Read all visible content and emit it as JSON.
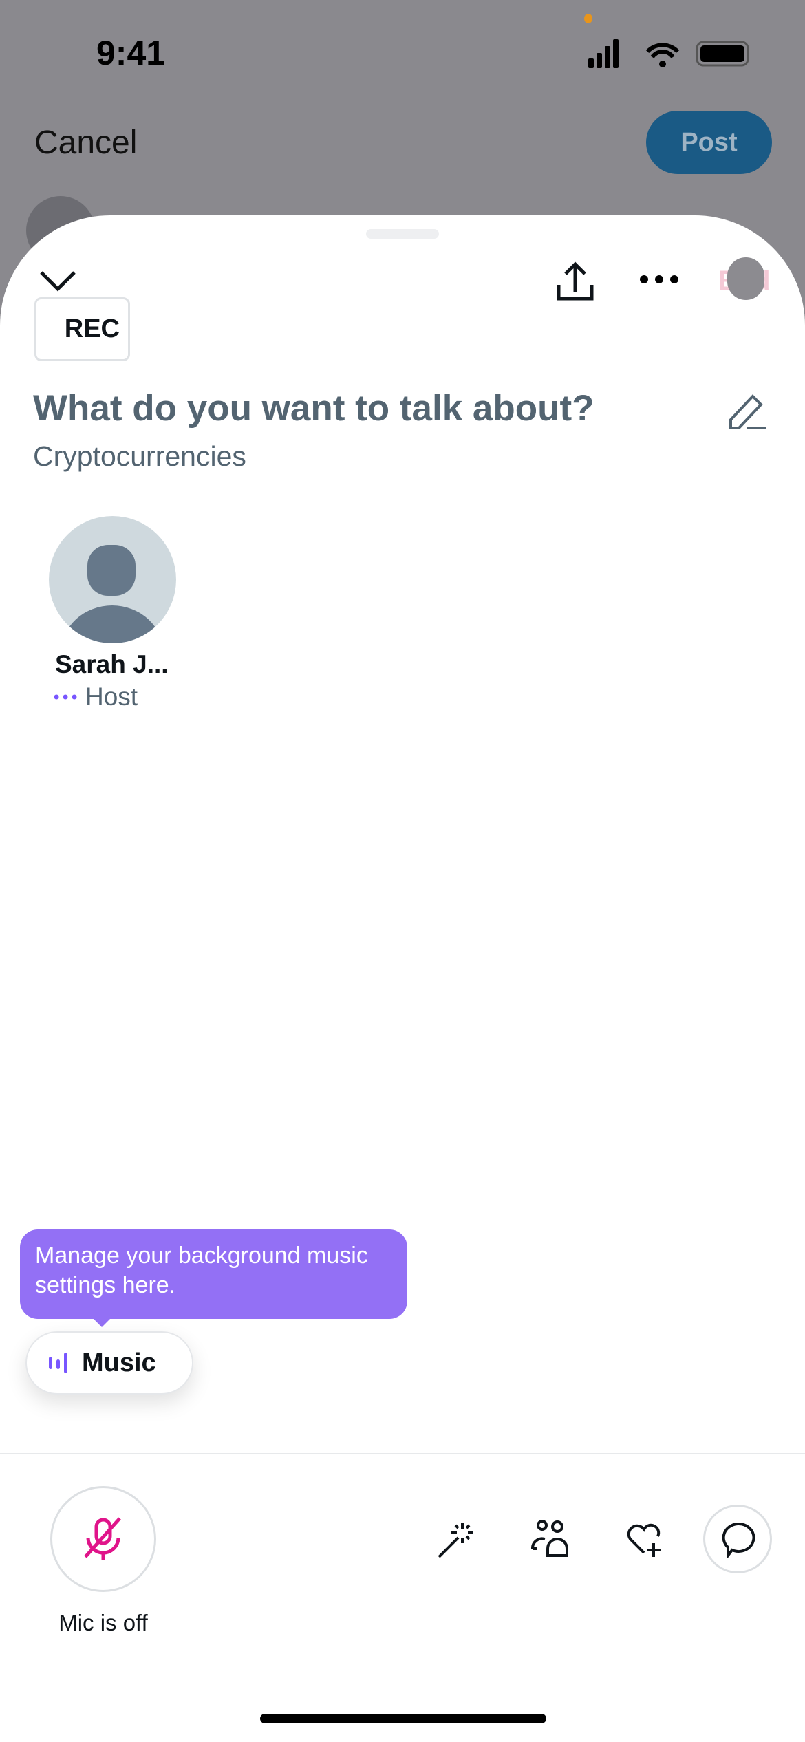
{
  "status_bar": {
    "time": "9:41"
  },
  "composer": {
    "cancel_label": "Cancel",
    "post_label": "Post"
  },
  "space": {
    "rec_label": "REC",
    "title": "What do you want to talk about?",
    "topic": "Cryptocurrencies",
    "end_label": "End",
    "participants": [
      {
        "name": "Sarah J...",
        "role": "Host"
      }
    ]
  },
  "tooltip": {
    "text": "Manage your background music settings here."
  },
  "music": {
    "label": "Music"
  },
  "controls": {
    "mic_label": "Mic is off"
  },
  "colors": {
    "accent": "#9370f5",
    "mic_off": "#e0148a",
    "post": "#1a5a85"
  }
}
